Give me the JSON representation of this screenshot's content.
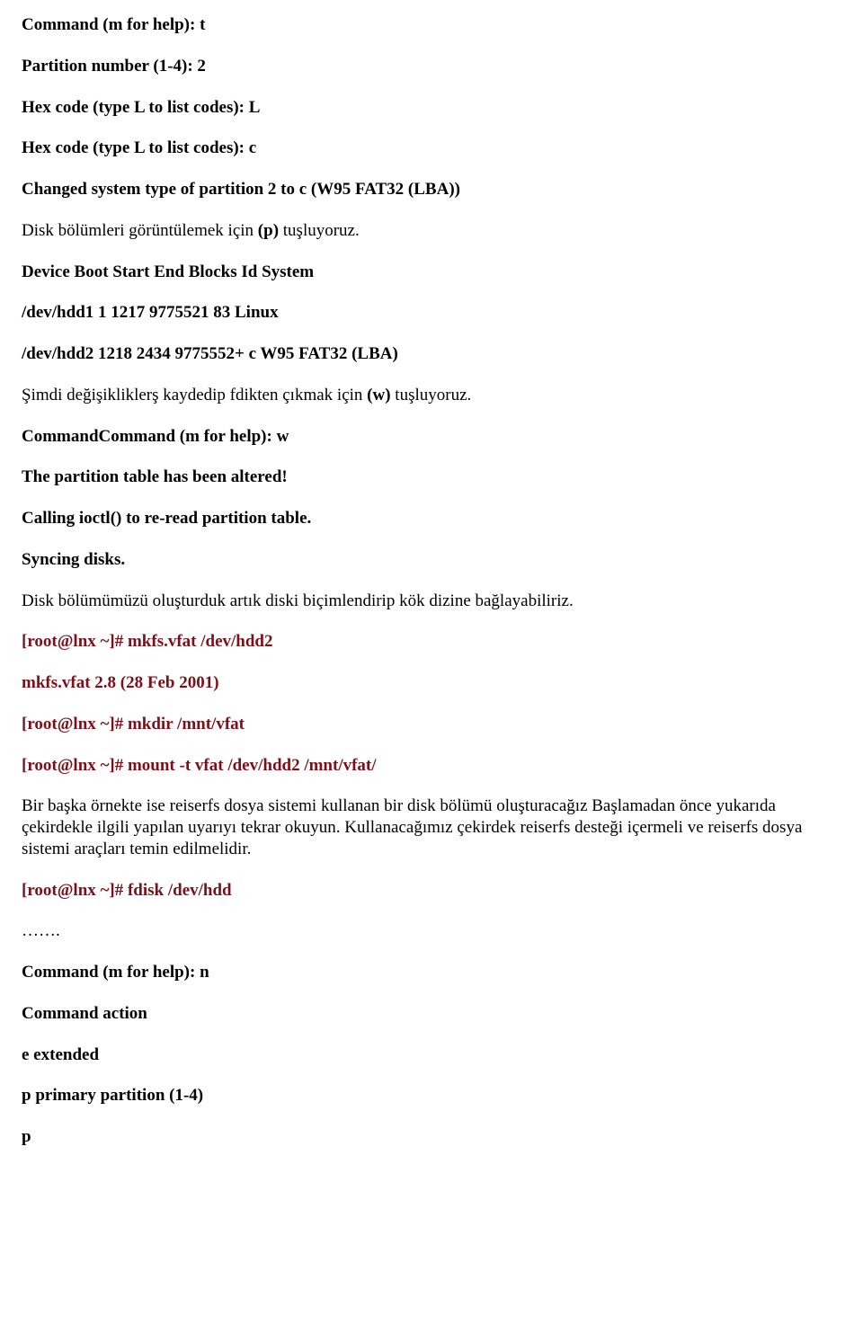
{
  "lines": {
    "l1": "Command (m for help): t",
    "l2": "Partition number (1-4): 2",
    "l3": "Hex code (type L to list codes): L",
    "l4": "Hex code (type L to list codes): c",
    "l5": "Changed system type of partition 2 to c (W95 FAT32 (LBA))",
    "l6a": "Disk bölümleri görüntülemek için ",
    "l6b": "(p)",
    "l6c": " tuşluyoruz.",
    "l7": "Device Boot Start End Blocks Id System",
    "l8": "/dev/hdd1 1 1217 9775521 83 Linux",
    "l9": "/dev/hdd2 1218 2434 9775552+ c W95 FAT32 (LBA)",
    "l10a": "Şimdi değişikliklerş kaydedip fdikten çıkmak için ",
    "l10b": "(w)",
    "l10c": " tuşluyoruz.",
    "l11": "CommandCommand (m for help): w",
    "l12": "The partition table has been altered!",
    "l13": "Calling ioctl() to re-read partition table.",
    "l14": "Syncing disks.",
    "l15": "Disk bölümümüzü oluşturduk artık diski biçimlendirip kök dizine bağlayabiliriz.",
    "l16": "[root@lnx ~]# mkfs.vfat  /dev/hdd2",
    "l17": "mkfs.vfat 2.8 (28 Feb 2001)",
    "l18": "[root@lnx ~]# mkdir  /mnt/vfat",
    "l19": "[root@lnx ~]# mount -t vfat  /dev/hdd2   /mnt/vfat/",
    "l20": "Bir başka örnekte ise reiserfs dosya sistemi kullanan bir disk bölümü oluşturacağız Başlamadan önce yukarıda çekirdekle ilgili yapılan uyarıyı tekrar okuyun. Kullanacağımız çekirdek reiserfs desteği içermeli ve reiserfs dosya sistemi araçları temin edilmelidir.",
    "l21": "[root@lnx ~]# fdisk /dev/hdd",
    "l22": "…….",
    "l23": "Command (m for help): n",
    "l24": "Command action",
    "l25": "e extended",
    "l26": "p primary partition (1-4)",
    "l27": "p"
  }
}
